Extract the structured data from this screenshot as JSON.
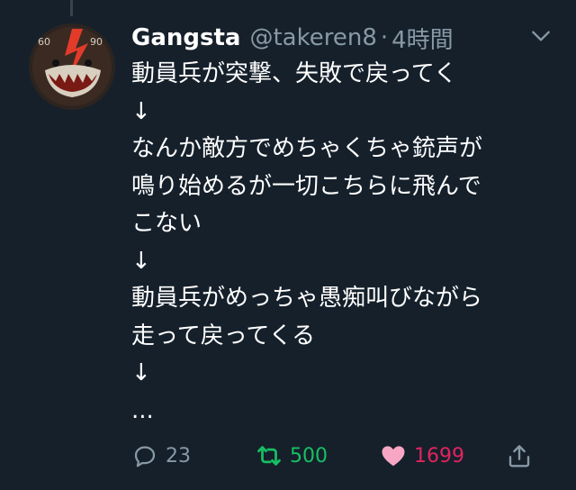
{
  "tweet": {
    "author_name": "Gangsta",
    "author_handle": "@takeren8",
    "separator": "·",
    "timestamp": "4時間",
    "lines": [
      "動員兵が突撃、失敗で戻ってく",
      "↓",
      "なんか敵方でめちゃくちゃ銃声が",
      "鳴り始めるが一切こちらに飛んで",
      "こない",
      "↓",
      "動員兵がめっちゃ愚痴叫びながら",
      "走って戻ってくる",
      "↓",
      "..."
    ]
  },
  "avatar": {
    "left_number": "60",
    "right_number": "90"
  },
  "actions": {
    "reply_count": "23",
    "retweet_count": "500",
    "like_count": "1699"
  },
  "colors": {
    "background": "#15202b",
    "secondary_text": "#8899a6",
    "retweet_active": "#17bf63",
    "like_active": "#e0245e",
    "like_heart": "#f7a7c3"
  },
  "icons": {
    "chevron": "chevron-down-icon",
    "reply": "reply-icon",
    "retweet": "retweet-icon",
    "like": "heart-icon",
    "share": "share-icon"
  }
}
